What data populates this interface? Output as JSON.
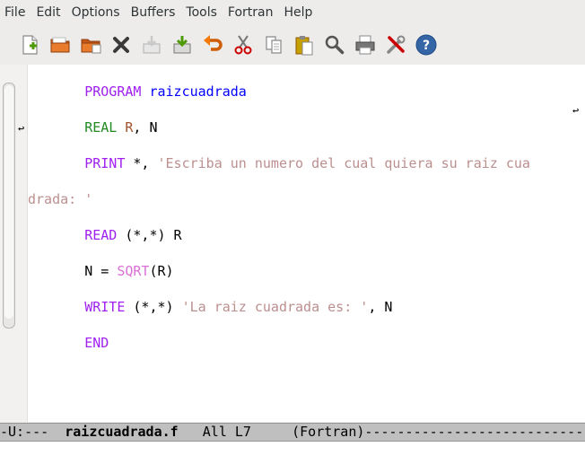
{
  "menubar": {
    "items": [
      "File",
      "Edit",
      "Options",
      "Buffers",
      "Tools",
      "Fortran",
      "Help"
    ]
  },
  "toolbar": {
    "icons": [
      "new-file-icon",
      "open-folder-icon",
      "dired-icon",
      "close-icon",
      "save-icon",
      "save-as-icon",
      "undo-icon",
      "cut-icon",
      "copy-icon",
      "paste-icon",
      "search-icon",
      "print-icon",
      "preferences-icon",
      "help-icon"
    ]
  },
  "code": {
    "line1_kw": "PROGRAM",
    "line1_name": "raizcuadrada",
    "line2_kw": "REAL",
    "line2_var": "R",
    "line2_rest": ", N",
    "line3_kw": "PRINT",
    "line3_mid": " *, ",
    "line3_str": "'Escriba un numero del cual quiera su raiz cua",
    "line3_cont": "drada: '",
    "line4_kw": "READ",
    "line4_rest": " (*,*) R",
    "line5_pre": "N = ",
    "line5_fn": "SQRT",
    "line5_rest": "(R)",
    "line6_kw": "WRITE",
    "line6_mid": " (*,*) ",
    "line6_str": "'La raiz cuadrada es: '",
    "line6_rest": ", N",
    "line7_kw": "END"
  },
  "modeline": {
    "status": "-U:---  ",
    "buffer_name": "raizcuadrada.f",
    "position": "   All L7     ",
    "mode": "(Fortran)",
    "filler": "-------------------------------"
  },
  "colors": {
    "keyword": "#a020f0",
    "type": "#228b22",
    "function_name": "#0000ff",
    "string": "#bc8f8f",
    "builtin": "#da70d6",
    "variable": "#a0522d"
  }
}
